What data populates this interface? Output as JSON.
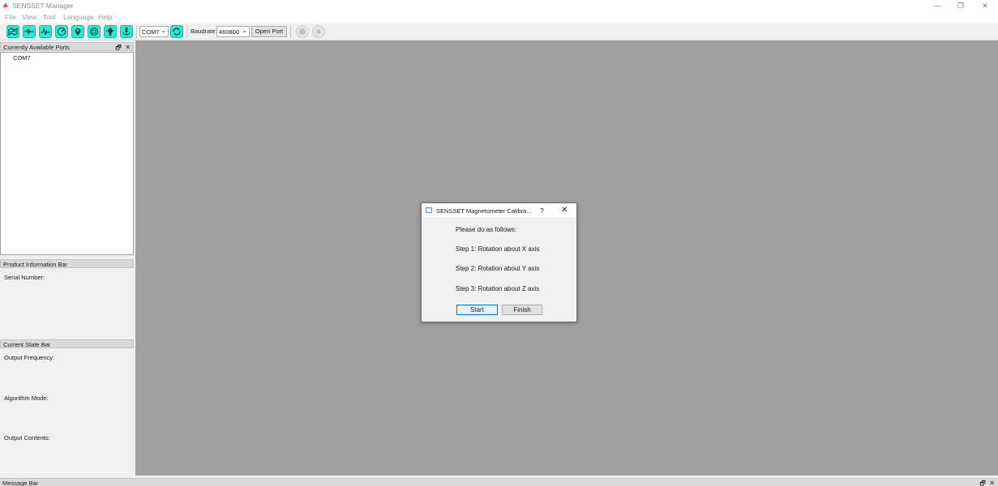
{
  "app": {
    "title": "SENSSET Manager",
    "window_controls": {
      "minimize": "—",
      "restore": "❐",
      "close": "✕"
    }
  },
  "menu": [
    "File",
    "View",
    "Tool",
    "Language",
    "Help"
  ],
  "toolbar": {
    "icons": [
      "map-icon",
      "waveform-icon",
      "pulse-icon",
      "gauge-icon",
      "location-pin-icon",
      "compass-icon",
      "settings-bulb-icon",
      "anchor-icon"
    ],
    "port_value": "COM7",
    "refresh_icon": "refresh-icon",
    "baudrate_label": "Baudrate:",
    "baudrate_value": "460800",
    "open_port_label": "Open Port",
    "record_icon": "record-icon",
    "stop_icon": "stop-icon",
    "accent_color": "#2ee6d4"
  },
  "ports_panel": {
    "title": "Currently Available Ports",
    "items": [
      "COM7"
    ]
  },
  "product_info": {
    "title": "Product Information Bar",
    "serial_label": "Serial Number:"
  },
  "state_panel": {
    "title": "Current State Bar",
    "output_frequency_label": "Output Frequency:",
    "algorithm_mode_label": "Algorithm Mode:",
    "output_contents_label": "Output Contents:"
  },
  "dialog": {
    "title": "SENSSET Magnetometer Calibra...",
    "help": "?",
    "close": "✕",
    "intro": "Please do as follows:",
    "steps": [
      "Step 1: Rotation about X axis",
      "Step 2: Rotation about Y axis",
      "Step 3: Rotation about Z axis"
    ],
    "start_label": "Start",
    "finish_label": "Finish"
  },
  "message_bar": {
    "title": "Message Bar"
  },
  "panel_controls": {
    "float": "🗗",
    "close": "✕"
  }
}
